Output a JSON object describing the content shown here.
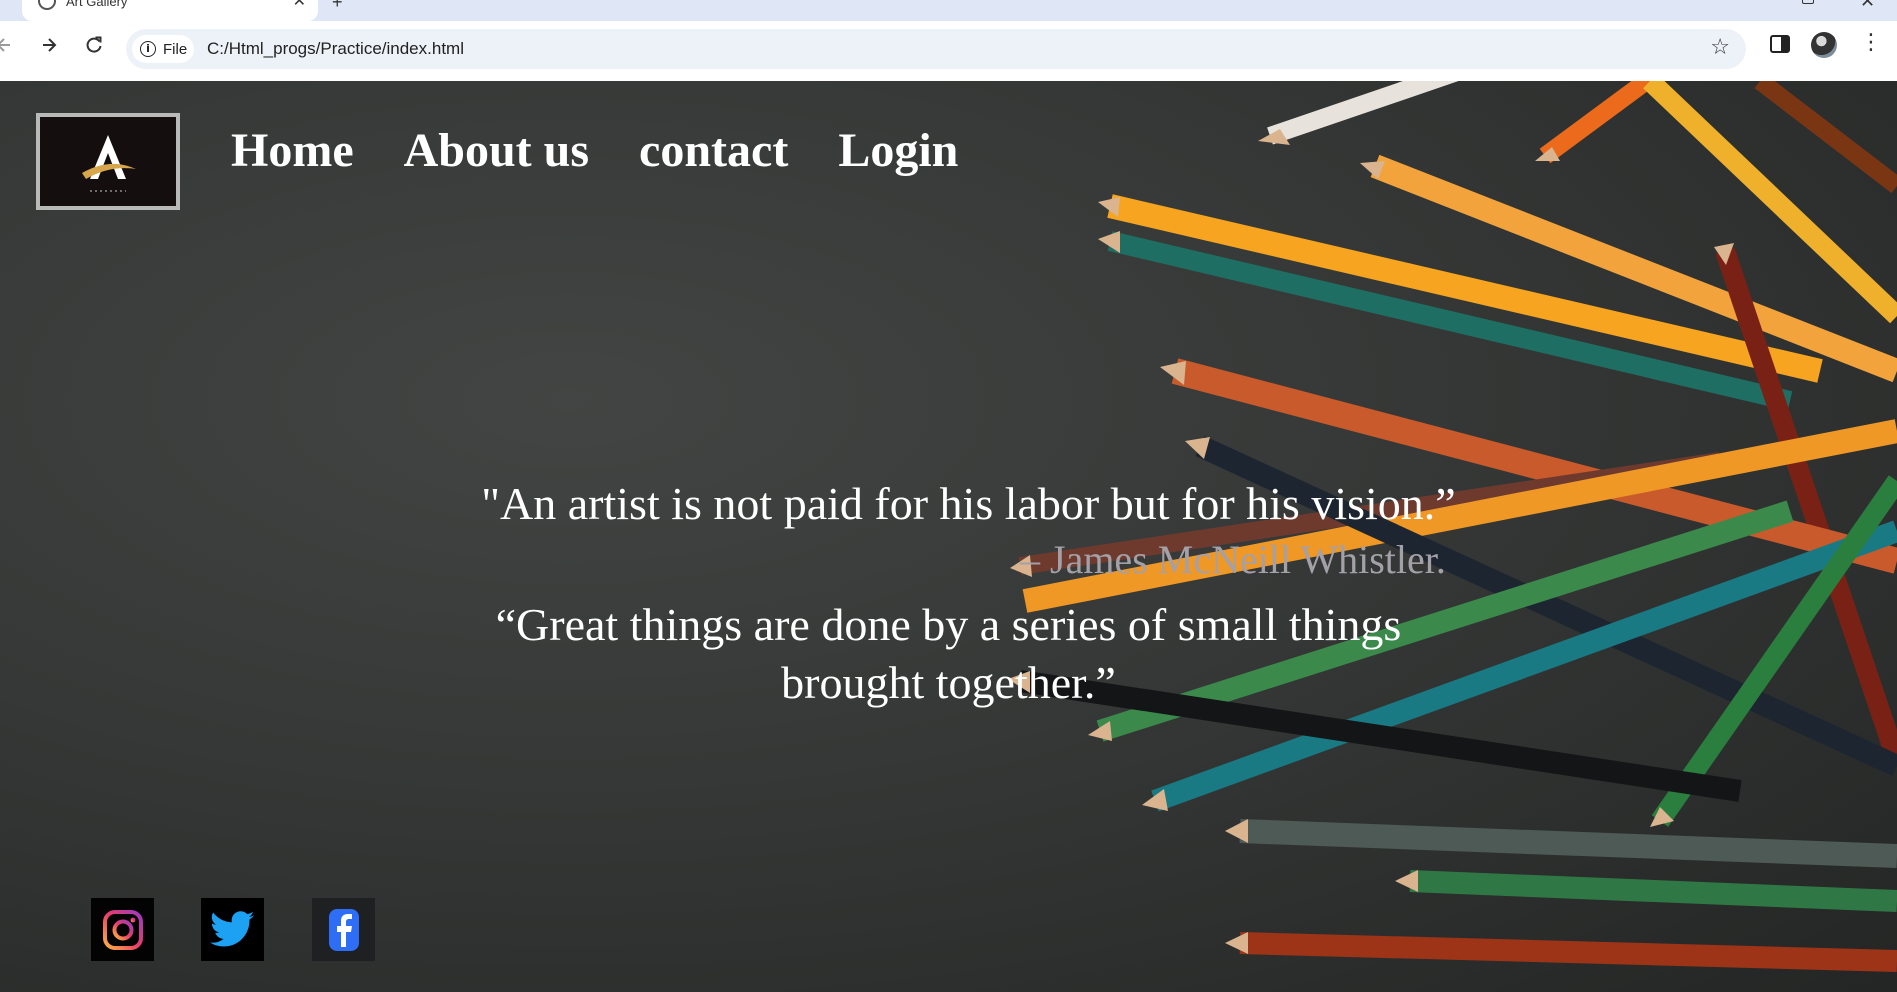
{
  "browser": {
    "tab_title": "Art Gallery",
    "url_chip": "File",
    "url": "C:/Html_progs/Practice/index.html"
  },
  "nav": {
    "items": [
      "Home",
      "About us",
      "contact",
      "Login"
    ]
  },
  "quotes": {
    "quote1": "\"An artist is not paid for his labor but for his vision.”",
    "author1": "– James McNeill Whistler.",
    "quote2_line1": "“Great things are done by a series of small things",
    "quote2_line2": "brought together.”"
  },
  "social": {
    "icons": [
      "instagram-icon",
      "twitter-icon",
      "facebook-icon"
    ]
  },
  "colors": {
    "background": "#353836",
    "text": "#ffffff",
    "author_text": "#a4a0a8",
    "tabstrip": "#dfe7f6"
  }
}
